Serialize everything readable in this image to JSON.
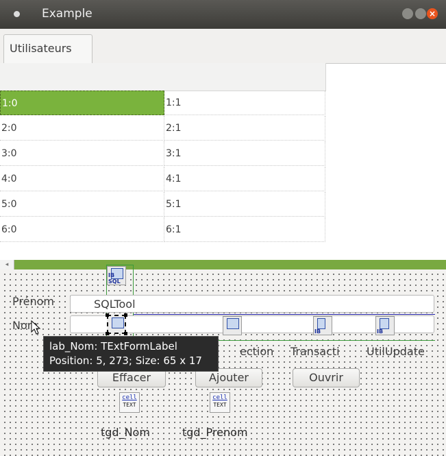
{
  "window": {
    "title": "Example"
  },
  "tabs": [
    {
      "label": "Utilisateurs"
    }
  ],
  "grid": {
    "rows": [
      [
        "1:0",
        "1:1"
      ],
      [
        "2:0",
        "2:1"
      ],
      [
        "3:0",
        "3:1"
      ],
      [
        "4:0",
        "4:1"
      ],
      [
        "5:0",
        "5:1"
      ],
      [
        "6:0",
        "6:1"
      ]
    ]
  },
  "form": {
    "prenom_label": "Prénom",
    "nom_label": "Nom",
    "prenom_value": "SQLTool"
  },
  "components": {
    "connection_label": "ection",
    "transaction_label": "Transacti",
    "utilupdate_label": "UtilUpdate",
    "sqltool_caption": "IB SQL",
    "ib_caption": "IB",
    "celltext_top": "cell",
    "celltext_bottom": "TEXT",
    "tgd_nom": "tgd_Nom",
    "tgd_prenom": "tgd_Prenom"
  },
  "buttons": {
    "effacer": "Effacer",
    "ajouter": "Ajouter",
    "ouvrir": "Ouvrir"
  },
  "tooltip": {
    "line1": "lab_Nom: TExtFormLabel",
    "line2": "Position: 5, 273; Size: 65 x 17"
  },
  "colors": {
    "selection": "#7ab33d",
    "titlebar": "#3d3c38",
    "close_button": "#e9541e"
  }
}
